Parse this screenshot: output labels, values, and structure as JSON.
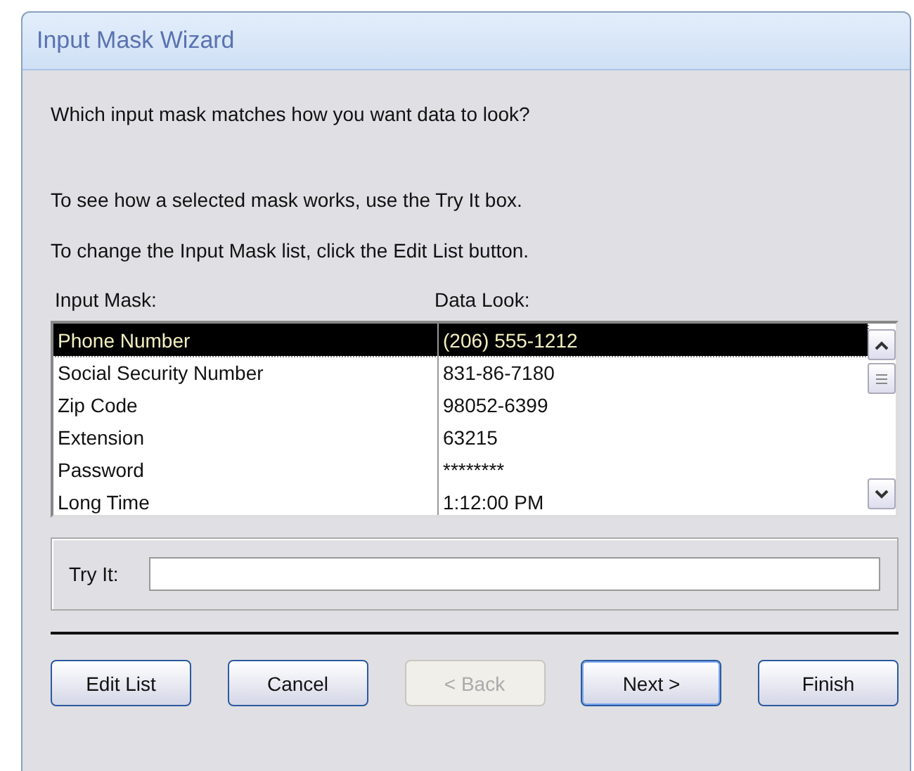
{
  "window": {
    "title": "Input Mask Wizard"
  },
  "question": "Which input mask matches how you want data to look?",
  "instructions": [
    "To see how a selected mask works, use the Try It box.",
    "To change the Input Mask list, click the Edit List button."
  ],
  "list": {
    "columns": [
      "Input Mask:",
      "Data Look:"
    ],
    "rows": [
      {
        "mask": "Phone Number",
        "look": "(206) 555-1212",
        "selected": true
      },
      {
        "mask": "Social Security Number",
        "look": "831-86-7180",
        "selected": false
      },
      {
        "mask": "Zip Code",
        "look": "98052-6399",
        "selected": false
      },
      {
        "mask": "Extension",
        "look": "63215",
        "selected": false
      },
      {
        "mask": "Password",
        "look": "********",
        "selected": false
      },
      {
        "mask": "Long Time",
        "look": "1:12:00 PM",
        "selected": false
      }
    ]
  },
  "try_it": {
    "label": "Try It:"
  },
  "buttons": [
    {
      "label": "Edit List",
      "disabled": false,
      "default": false
    },
    {
      "label": "Cancel",
      "disabled": false,
      "default": false
    },
    {
      "label": "< Back",
      "disabled": true,
      "default": false
    },
    {
      "label": "Next >",
      "disabled": false,
      "default": true
    },
    {
      "label": "Finish",
      "disabled": false,
      "default": false
    }
  ]
}
